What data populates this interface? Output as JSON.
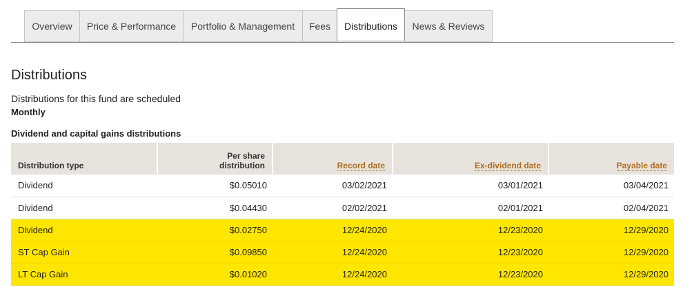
{
  "tabs": [
    {
      "label": "Overview"
    },
    {
      "label": "Price & Performance"
    },
    {
      "label": "Portfolio & Management"
    },
    {
      "label": "Fees"
    },
    {
      "label": "Distributions",
      "active": true
    },
    {
      "label": "News & Reviews"
    }
  ],
  "section": {
    "title": "Distributions",
    "schedule_text": "Distributions for this fund are scheduled",
    "schedule_frequency": "Monthly",
    "table_heading": "Dividend and capital gains distributions"
  },
  "table": {
    "headers": {
      "type": "Distribution type",
      "per_share_line1": "Per share",
      "per_share_line2": "distribution",
      "record_date": "Record date",
      "ex_dividend_date": "Ex-dividend date",
      "payable_date": "Payable date"
    },
    "rows": [
      {
        "type": "Dividend",
        "amount": "$0.05010",
        "record": "03/02/2021",
        "ex": "03/01/2021",
        "payable": "03/04/2021",
        "highlighted": false
      },
      {
        "type": "Dividend",
        "amount": "$0.04430",
        "record": "02/02/2021",
        "ex": "02/01/2021",
        "payable": "02/04/2021",
        "highlighted": false
      },
      {
        "type": "Dividend",
        "amount": "$0.02750",
        "record": "12/24/2020",
        "ex": "12/23/2020",
        "payable": "12/29/2020",
        "highlighted": true
      },
      {
        "type": "ST Cap Gain",
        "amount": "$0.09850",
        "record": "12/24/2020",
        "ex": "12/23/2020",
        "payable": "12/29/2020",
        "highlighted": true
      },
      {
        "type": "LT Cap Gain",
        "amount": "$0.01020",
        "record": "12/24/2020",
        "ex": "12/23/2020",
        "payable": "12/29/2020",
        "highlighted": true
      }
    ]
  },
  "colors": {
    "highlight": "#ffe600",
    "header_bg": "#e7e3dc",
    "sort_link": "#b06d1f"
  }
}
